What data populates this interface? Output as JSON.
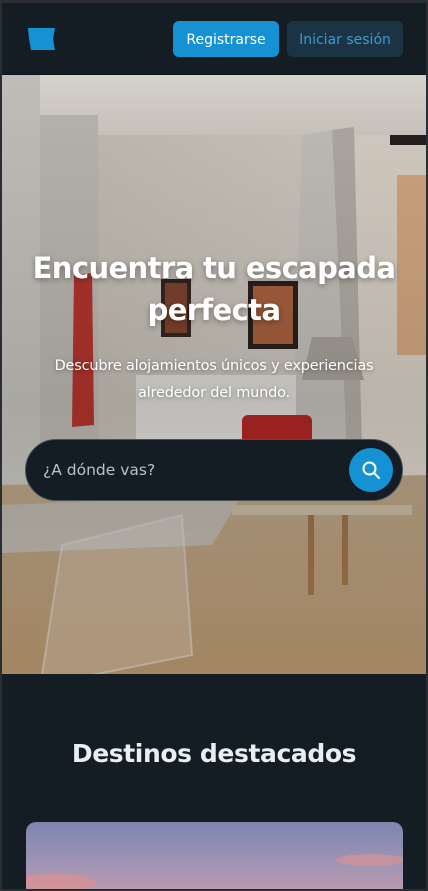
{
  "navbar": {
    "logo_icon": "brand-logo-icon",
    "register_label": "Registrarse",
    "login_label": "Iniciar sesión"
  },
  "hero": {
    "title": "Encuentra tu escapada perfecta",
    "subtitle": "Descubre alojamientos únicos y experiencias alrededor del mundo.",
    "search": {
      "placeholder": "¿A dónde vas?",
      "button_icon": "search-icon"
    }
  },
  "featured": {
    "title": "Destinos destacados"
  },
  "colors": {
    "background": "#131d23",
    "accent": "#1592d4",
    "secondary_button_bg": "#1c3344",
    "secondary_button_text": "#3a9bd5"
  }
}
